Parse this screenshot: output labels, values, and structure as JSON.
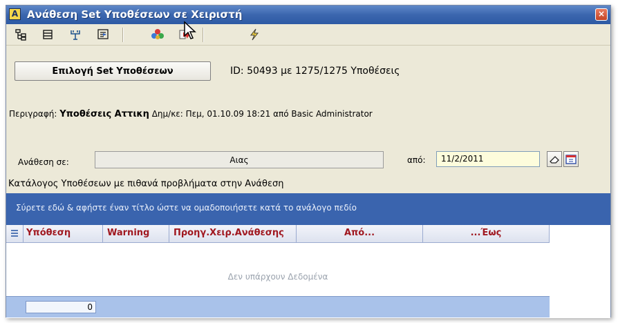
{
  "window": {
    "title": "Ανάθεση Set Υποθέσεων σε Χειριστή",
    "app_icon_letter": "A",
    "close_label": "×"
  },
  "toolbar": {
    "icons": [
      "tree-view-icon",
      "collapse-icon",
      "filter-icon",
      "export-icon",
      "color-balls-icon",
      "forward-arrow-icon",
      "lightning-icon"
    ]
  },
  "selection": {
    "button_label": "Επιλογή Set Υποθέσεων",
    "id_info": "ID: 50493 με 1275/1275 Υποθέσεις"
  },
  "description": {
    "label": "Περιγραφή:",
    "value": "Υποθέσεις Αττικη",
    "created_label": "Δημ/κε:",
    "created_value": "Πεμ, 01.10.09 18:21 από Basic Administrator"
  },
  "assignment": {
    "label": "Ανάθεση σε:",
    "assignee": "Αιας",
    "from_label": "από:",
    "from_date": "11/2/2011"
  },
  "list": {
    "caption": "Κατάλογος Υποθέσεων με πιθανά προβλήματα στην Ανάθεση",
    "group_hint": "Σύρετε εδώ & αφήστε έναν τίτλο ώστε να ομαδοποιήσετε κατά το ανάλογο πεδίο",
    "columns": [
      "Υπόθεση",
      "Warning",
      "Προηγ.Χειρ.Ανάθεσης",
      "Από...",
      "...Έως"
    ],
    "empty_message": "Δεν υπάρχουν Δεδομένα",
    "footer_count": "0"
  }
}
